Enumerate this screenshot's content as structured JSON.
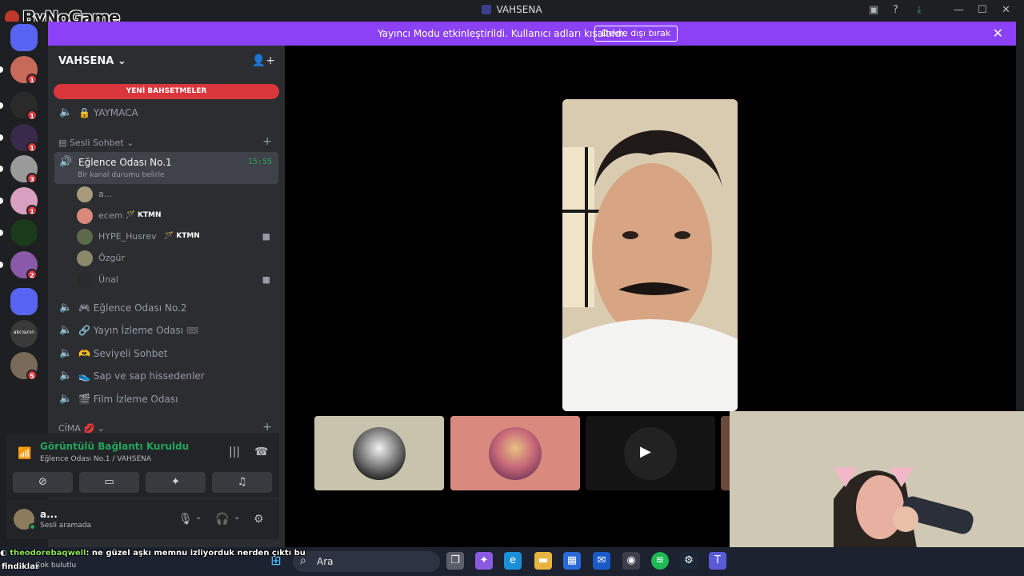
{
  "window": {
    "title": "VAHSENA"
  },
  "watermark": "ByNoGame",
  "banner": {
    "text": "Yayıncı Modu etkinleştirildi. Kullanıcı adları kısaltıldı.",
    "button": "Devre dışı bırak",
    "close": "✕"
  },
  "servers": [
    {
      "badge": "1",
      "color": "#c86a5a"
    },
    {
      "badge": "1",
      "color": "#2a2a2a"
    },
    {
      "badge": "1",
      "color": "#3a2a4a"
    },
    {
      "badge": "3",
      "color": "#9a9a9a"
    },
    {
      "badge": "1",
      "color": "#d8a0c0"
    },
    {
      "badge": "",
      "color": "#1a3a1a"
    },
    {
      "badge": "2",
      "color": "#8a5aa8"
    },
    {
      "badge": "",
      "color": "#5865f2"
    },
    {
      "badge": "",
      "color": "#3a3a3a",
      "label": "akcısının"
    },
    {
      "badge": "5",
      "color": "#7a6a5a"
    }
  ],
  "sidebar": {
    "server_name": "VAHSENA",
    "mentions_label": "YENİ BAHSETMELER",
    "top_channel": "🔒 YAYMACA",
    "category_voice": "Sesli Sohbet",
    "active_channel": {
      "name": "Eğlence Odası No.1",
      "time": "15:55",
      "status": "Bir kanal durumu belirle"
    },
    "voice_users": [
      {
        "name": "a...",
        "tag": "",
        "camera": false,
        "color": "#a89a7a"
      },
      {
        "name": "ecem",
        "tag": "KTMN",
        "camera": false,
        "color": "#d88a7a"
      },
      {
        "name": "HYPE_Husrev",
        "tag": "KTMN",
        "camera": true,
        "color": "#5a6a4a"
      },
      {
        "name": "Özgür",
        "tag": "",
        "camera": false,
        "color": "#8a8a6a"
      },
      {
        "name": "Ünal",
        "tag": "",
        "camera": true,
        "color": "#2a2a2a"
      }
    ],
    "channels": [
      "Eğlence Odası No.2",
      "Yayın İzleme Odası 🎟",
      "Seviyeli Sohbet",
      "Sap ve sap hissedenler",
      "Film İzleme Odası"
    ],
    "category_2": "CİMA"
  },
  "voice_panel": {
    "title": "Görüntülü Bağlantı Kuruldu",
    "subtitle": "Eğlence Odası No.1 / VAHSENA"
  },
  "user_panel": {
    "name": "a...",
    "status": "Sesli aramada"
  },
  "taskbar": {
    "search_placeholder": "Ara"
  },
  "chat_overlay": {
    "user": "theodorebaqwell",
    "message": ": ne güzel aşkı memnu izliyorduk nerden çıktı bu",
    "line2": "findiklar",
    "line3": "Çok bulutlu"
  }
}
